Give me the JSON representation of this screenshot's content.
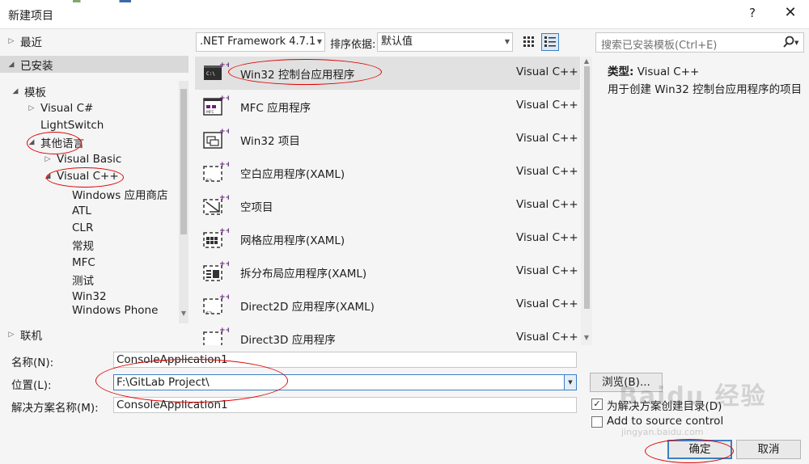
{
  "window": {
    "title": "新建项目",
    "help": "?",
    "close": "✕"
  },
  "tree": {
    "recent": "最近",
    "installed": "已安装",
    "templates": "模板",
    "visual_csharp": "Visual C#",
    "lightswitch": "LightSwitch",
    "other_languages": "其他语言",
    "visual_basic": "Visual Basic",
    "visual_cpp": "Visual C++",
    "cpp_children": [
      "Windows 应用商店",
      "ATL",
      "CLR",
      "常规",
      "MFC",
      "测试",
      "Win32",
      "Windows Phone"
    ],
    "online": "联机"
  },
  "toolbar": {
    "framework": ".NET Framework 4.7.1",
    "sort_label": "排序依据:",
    "sort_value": "默认值"
  },
  "templates": [
    {
      "name": "Win32 控制台应用程序",
      "lang": "Visual C++",
      "icon": "console-icon"
    },
    {
      "name": "MFC 应用程序",
      "lang": "Visual C++",
      "icon": "mfc-icon"
    },
    {
      "name": "Win32 项目",
      "lang": "Visual C++",
      "icon": "win32-icon"
    },
    {
      "name": "空白应用程序(XAML)",
      "lang": "Visual C++",
      "icon": "blank-app-icon"
    },
    {
      "name": "空项目",
      "lang": "Visual C++",
      "icon": "empty-project-icon"
    },
    {
      "name": "网格应用程序(XAML)",
      "lang": "Visual C++",
      "icon": "grid-app-icon"
    },
    {
      "name": "拆分布局应用程序(XAML)",
      "lang": "Visual C++",
      "icon": "split-app-icon"
    },
    {
      "name": "Direct2D 应用程序(XAML)",
      "lang": "Visual C++",
      "icon": "direct2d-icon"
    },
    {
      "name": "Direct3D 应用程序",
      "lang": "Visual C++",
      "icon": "direct3d-icon"
    }
  ],
  "search": {
    "placeholder": "搜索已安装模板(Ctrl+E)"
  },
  "details": {
    "type_label": "类型:",
    "type_value": "Visual C++",
    "description": "用于创建 Win32 控制台应用程序的项目"
  },
  "form": {
    "name_label": "名称(N):",
    "name_value": "ConsoleApplication1",
    "location_label": "位置(L):",
    "location_value": "F:\\GitLab Project\\",
    "solution_label": "解决方案名称(M):",
    "solution_value": "ConsoleApplication1",
    "browse": "浏览(B)...",
    "create_dir": "为解决方案创建目录(D)",
    "create_dir_checked": true,
    "add_source_control": "Add to source control",
    "ok": "确定",
    "cancel": "取消"
  },
  "watermark": {
    "brand": "Baidu 经验",
    "url": "jingyan.baidu.com"
  },
  "colors": {
    "accent": "#3c7fc4",
    "vs_purple": "#68217a",
    "annotation": "#e00000"
  }
}
